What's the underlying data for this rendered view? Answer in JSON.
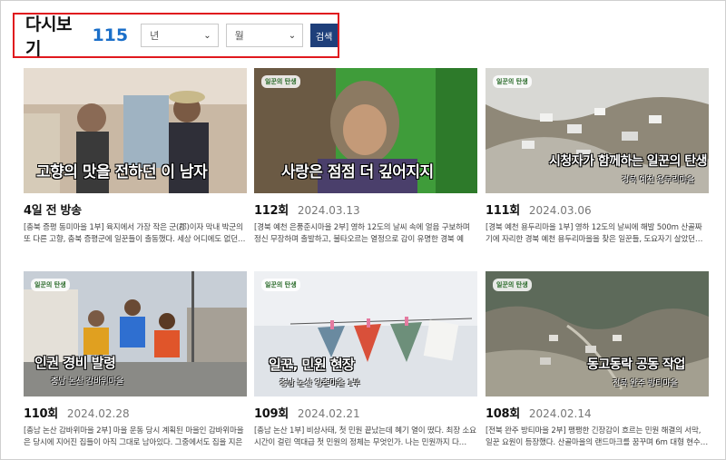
{
  "header": {
    "title": "다시보기",
    "count": "115",
    "year_select": "년",
    "month_select": "월",
    "search_label": "검색"
  },
  "episodes": [
    {
      "episode": "4일 전 방송",
      "date": "",
      "description": "[충북 증평 동미마을 1부] 육지에서 가장 작은 군(郡)이자 막내 박군의 또 다른 고향, 충북 증평군에 일꾼들이 출동했다. 세상 어디에도 없던…",
      "thumb_caption": "고향의 맛을 전하던 이 남자",
      "thumb_sub": ""
    },
    {
      "episode": "112회",
      "date": "2024.03.13",
      "description": "[경북 예천 은풍준시마을 2부] 영하 12도의 날씨 속에 얼음 구보하며 정신 무장하며 출발하고, 불타오르는 열정으로 감이 유명한 경북 예천…",
      "thumb_caption": "사랑은 점점 더 깊어지지",
      "thumb_sub": ""
    },
    {
      "episode": "111회",
      "date": "2024.03.06",
      "description": "[경북 예천 용두리마을 1부] 영하 12도의 날씨에 해발 500m 산골짜기에 자리한 경북 예천 용두리마을을 찾은 일꾼들, 도요자기 살았던…",
      "thumb_caption": "시청자가 함께하는 일꾼의 탄생",
      "thumb_sub": "경북 예천 용두리마을"
    },
    {
      "episode": "110회",
      "date": "2024.02.28",
      "description": "[충남 논산 감바위마을 2부] 마을 운동 당시 계획된 마을인 감바위마을은 당시에 지어진 집들이 아직 그대로 남아있다. 그중에서도 집을 지은 이…",
      "thumb_caption": "인권 경비 발령",
      "thumb_sub": "충남 논산 감바위마을"
    },
    {
      "episode": "109회",
      "date": "2024.02.21",
      "description": "[충남 논산 1부] 비상사태, 첫 민원 끝났는데 혜기 열이 떴다. 최장 소요 시간이 걸린 역대급 첫 민원의 정체는 무엇인가. 나는 민원까지 다…",
      "thumb_caption": "일꾼, 민원 현장",
      "thumb_sub": "충남 논산 양촌마을 1부"
    },
    {
      "episode": "108회",
      "date": "2024.02.14",
      "description": "[전북 완주 방티마을 2부] 팽팽한 긴장감이 흐르는 민원 해결의 서막, 일꾼 요원이 등장했다. 산골마을의 랜드마크를 꿈꾸며 6m 대형 현수…",
      "thumb_caption": "동고동락 공동 작업",
      "thumb_sub": "전북 완주 방티마을"
    }
  ],
  "colors": {
    "accent_red": "#e0181e",
    "count_blue": "#1b6fc9",
    "button_navy": "#1e3f7a"
  }
}
